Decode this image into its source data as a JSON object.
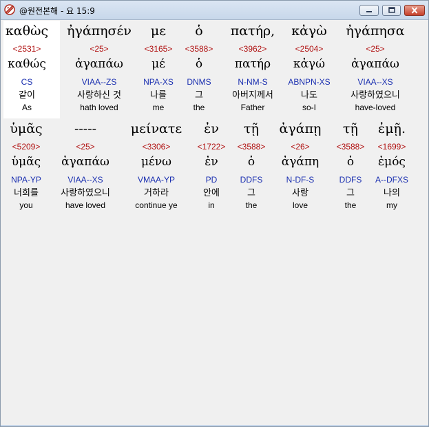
{
  "window": {
    "title": "@원전본해 - 요 15:9"
  },
  "rows": [
    {
      "words": [
        {
          "greek": "καθὼς",
          "number": "<2531>",
          "lemma": "καθώς",
          "morph": "CS",
          "korean": "같이",
          "english": "As"
        },
        {
          "greek": "ἠγάπησέν",
          "number": "<25>",
          "lemma": "ἀγαπάω",
          "morph": "VIAA--ZS",
          "korean": "사랑하신 것",
          "english": "hath loved"
        },
        {
          "greek": "με",
          "number": "<3165>",
          "lemma": "μέ",
          "morph": "NPA-XS",
          "korean": "나를",
          "english": "me"
        },
        {
          "greek": "ὁ",
          "number": "<3588>",
          "lemma": "ὁ",
          "morph": "DNMS",
          "korean": "그",
          "english": "the"
        },
        {
          "greek": "πατήρ,",
          "number": "<3962>",
          "lemma": "πατήρ",
          "morph": "N-NM-S",
          "korean": "아버지께서",
          "english": "Father"
        },
        {
          "greek": "κἀγὼ",
          "number": "<2504>",
          "lemma": "κἀγώ",
          "morph": "ABNPN-XS",
          "korean": "나도",
          "english": "so-I"
        },
        {
          "greek": "ἠγάπησα",
          "number": "<25>",
          "lemma": "ἀγαπάω",
          "morph": "VIAA--XS",
          "korean": "사랑하였으니",
          "english": "have-loved"
        }
      ]
    },
    {
      "words": [
        {
          "greek": "ὑμᾶς",
          "number": "<5209>",
          "lemma": "ὑμᾶς",
          "morph": "NPA-YP",
          "korean": "너희를",
          "english": "you"
        },
        {
          "greek": "-----",
          "number": "<25>",
          "lemma": "ἀγαπάω",
          "morph": "VIAA--XS",
          "korean": "사랑하였으니",
          "english": "have loved"
        },
        {
          "greek": "μείνατε",
          "number": "<3306>",
          "lemma": "μένω",
          "morph": "VMAA-YP",
          "korean": "거하라",
          "english": "continue ye"
        },
        {
          "greek": "ἐν",
          "number": "<1722>",
          "lemma": "ἐν",
          "morph": "PD",
          "korean": "안에",
          "english": "in"
        },
        {
          "greek": "τῇ",
          "number": "<3588>",
          "lemma": "ὁ",
          "morph": "DDFS",
          "korean": "그",
          "english": "the"
        },
        {
          "greek": "ἀγάπῃ",
          "number": "<26>",
          "lemma": "ἀγάπη",
          "morph": "N-DF-S",
          "korean": "사랑",
          "english": "love"
        },
        {
          "greek": "τῇ",
          "number": "<3588>",
          "lemma": "ὁ",
          "morph": "DDFS",
          "korean": "그",
          "english": "the"
        },
        {
          "greek": "ἐμῇ.",
          "number": "<1699>",
          "lemma": "ἐμός",
          "morph": "A--DFXS",
          "korean": "나의",
          "english": "my"
        }
      ]
    }
  ]
}
